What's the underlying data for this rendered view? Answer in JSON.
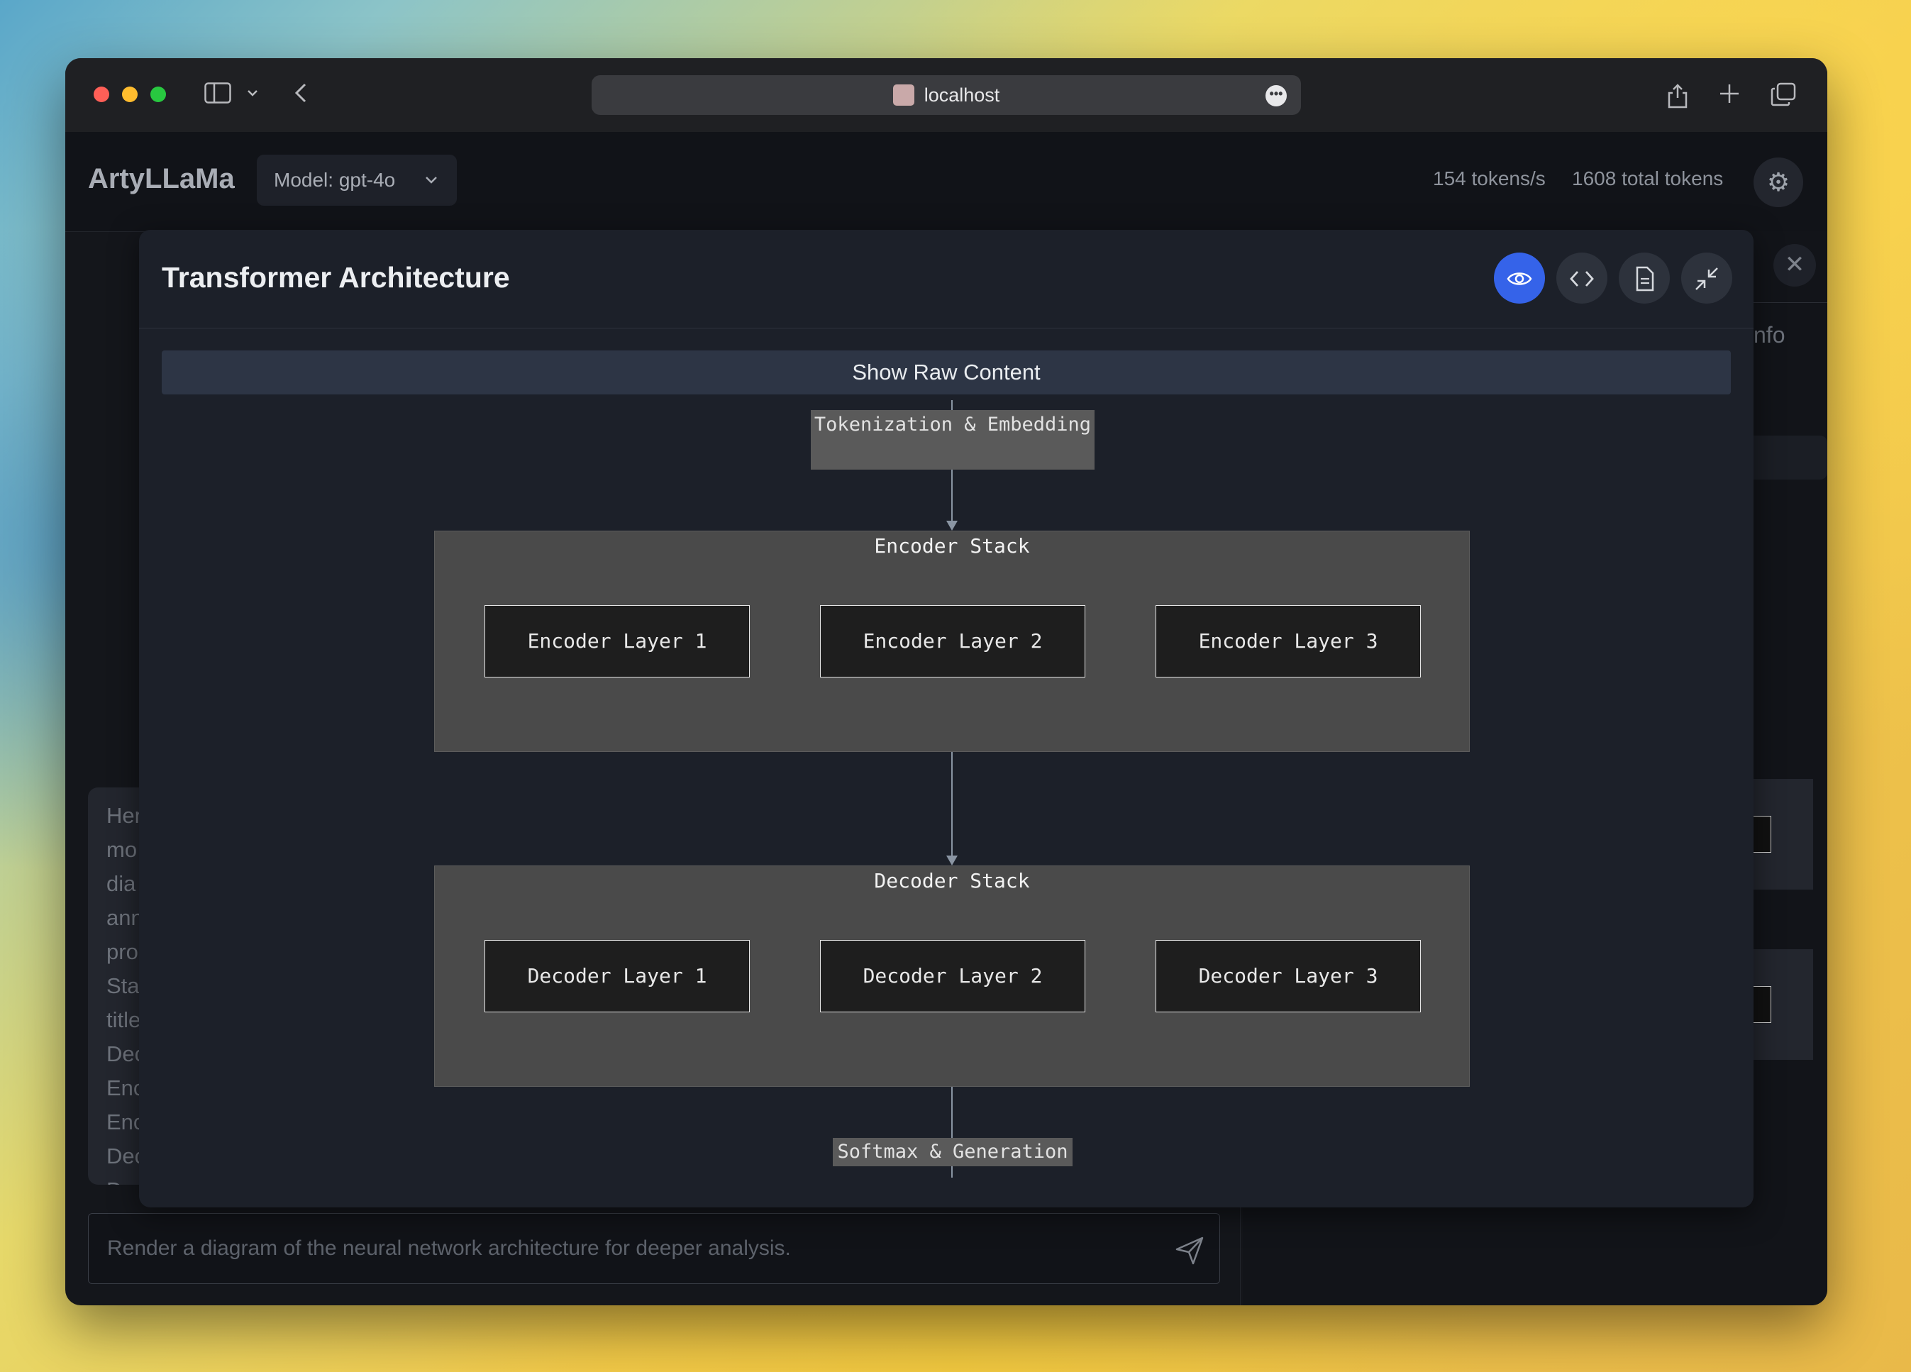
{
  "browser": {
    "url": "localhost"
  },
  "app": {
    "name": "ArtyLLaMa",
    "model_label": "Model: gpt-4o",
    "tokens_per_sec": "154 tokens/s",
    "total_tokens": "1608 total tokens"
  },
  "background": {
    "chat_fragments": [
      "Her",
      "mo",
      "dia",
      "ann",
      "pro",
      "Sta",
      "title",
      "Dec",
      "Enc",
      "Enc",
      "Dec",
      "D"
    ],
    "right_tab_fragment": "nfo",
    "input_placeholder": "Render a diagram of the neural network architecture for deeper analysis."
  },
  "modal": {
    "title": "Transformer Architecture",
    "raw_button": "Show Raw Content"
  },
  "diagram": {
    "tokenization": "Tokenization & Embedding",
    "encoder_stack": {
      "title": "Encoder Stack",
      "layers": [
        "Encoder Layer 1",
        "Encoder Layer 2",
        "Encoder Layer 3"
      ]
    },
    "decoder_stack": {
      "title": "Decoder Stack",
      "layers": [
        "Decoder Layer 1",
        "Decoder Layer 2",
        "Decoder Layer 3"
      ]
    },
    "output": "Softmax & Generation"
  },
  "colors": {
    "accent": "#3563e9",
    "modal_bg": "#1c2029",
    "stack_bg": "#4a4a4a"
  },
  "icons": [
    "sidebar-icon",
    "chevron-down-icon",
    "back-icon",
    "share-icon",
    "plus-icon",
    "tabs-icon",
    "gear-icon",
    "eye-icon",
    "code-icon",
    "document-icon",
    "minimize-icon",
    "close-icon",
    "send-icon"
  ]
}
